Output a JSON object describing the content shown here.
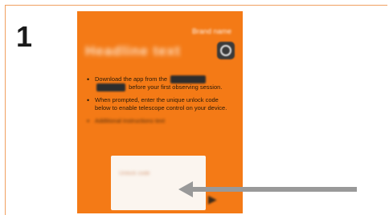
{
  "step": {
    "number": "1"
  },
  "card": {
    "brand_text": "Brand name",
    "headline_text": "Headline text",
    "bullets": [
      {
        "before": "Download the app from the",
        "after": "before your first observing session."
      },
      {
        "text": "When prompted, enter the unique unlock code below to enable telescope control on your device."
      },
      {
        "text": "Additional instructions text"
      }
    ],
    "code_box": {
      "code_text": "Unlock code"
    }
  },
  "colors": {
    "card_orange": "#f47a16",
    "code_box": "#fbf5ef",
    "arrow_gray": "#999999",
    "frame_border": "#f0a060"
  },
  "icons": [
    "globe-logo-icon",
    "pointer-arrow-icon",
    "chevron-right-icon"
  ]
}
